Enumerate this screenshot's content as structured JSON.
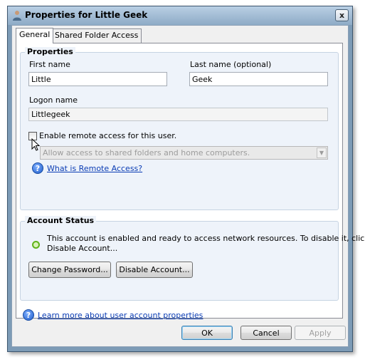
{
  "window": {
    "title": "Properties for Little Geek",
    "close_glyph": "x"
  },
  "tabs": [
    {
      "label": "General",
      "active": true
    },
    {
      "label": "Shared Folder Access",
      "active": false
    }
  ],
  "properties": {
    "title": "Properties",
    "first_name_label": "First name",
    "first_name_value": "Little",
    "last_name_label": "Last name (optional)",
    "last_name_value": "Geek",
    "logon_label": "Logon name",
    "logon_value": "Littlegeek",
    "remote_checkbox_label": "Enable remote access for this user.",
    "remote_checkbox_checked": false,
    "remote_access_select": "Allow access to shared folders and home computers.",
    "remote_help_link": "What is Remote Access?"
  },
  "account_status": {
    "title": "Account Status",
    "status_text_line1": "This account is enabled and ready to access network resources. To disable it, click",
    "status_text_line2": "Disable Account...",
    "change_password_button": "Change Password...",
    "disable_account_button": "Disable Account..."
  },
  "learn_more_link": "Learn more about user account properties",
  "footer": {
    "ok_button": "OK",
    "cancel_button": "Cancel",
    "apply_button": "Apply"
  },
  "colors": {
    "frame": "#7d9bb6",
    "group_fill": "#eef3fa",
    "link": "#0a3cb4",
    "status_green": "#5fb31a"
  }
}
